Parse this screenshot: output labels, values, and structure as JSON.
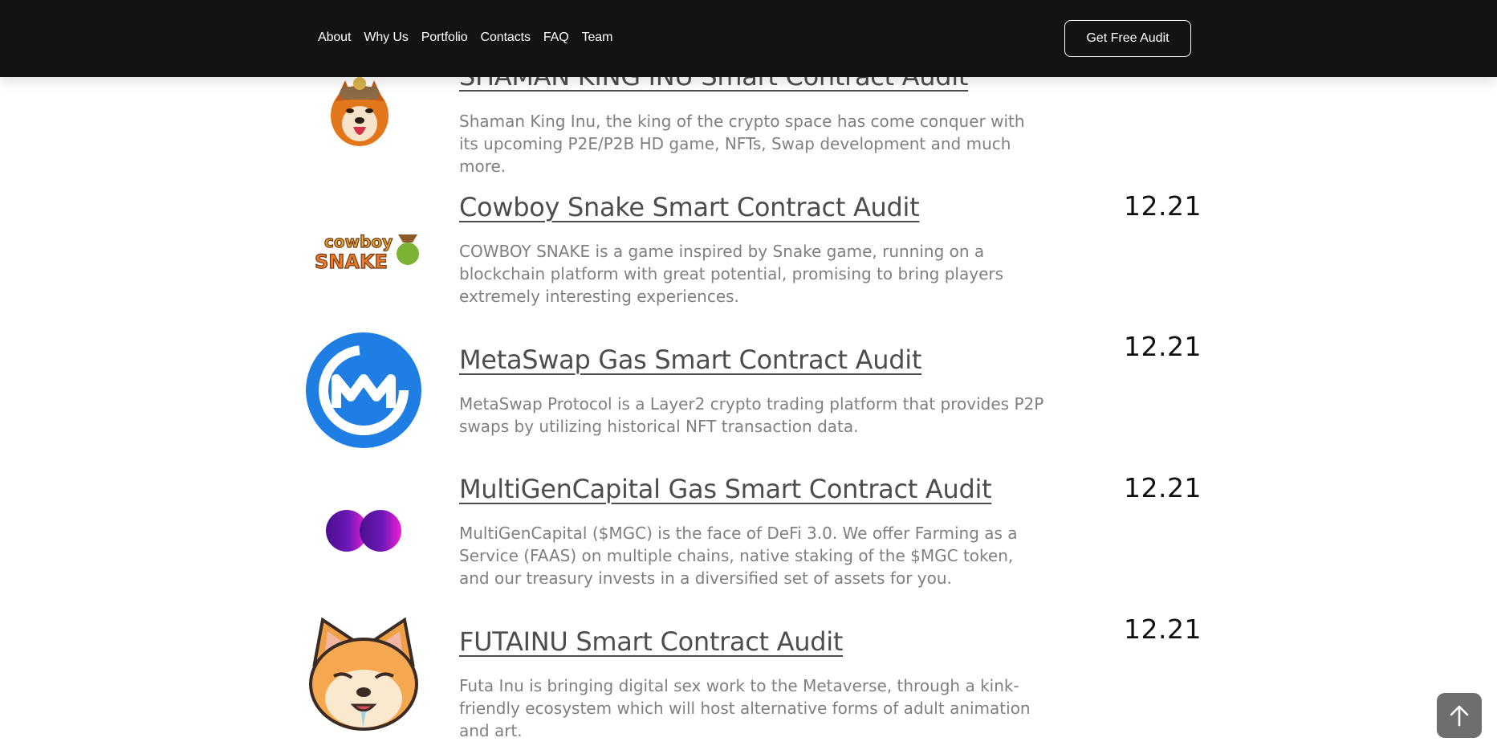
{
  "header": {
    "nav": [
      "About",
      "Why Us",
      "Portfolio",
      "Contacts",
      "FAQ",
      "Team"
    ],
    "cta_label": "Get Free Audit"
  },
  "audits": [
    {
      "title": "SHAMAN KING INU Smart Contract Audit",
      "description": "Shaman King Inu, the king of the crypto space has come conquer with its upcoming P2E/P2B HD game, NFTs, Swap development and much more.",
      "date": "",
      "logo_icon": "shiba-warrior-icon"
    },
    {
      "title": "Cowboy Snake Smart Contract Audit",
      "description": "COWBOY SNAKE is a game inspired by Snake game,  running on a blockchain platform with great potential, promising to bring players extremely interesting experiences.",
      "date": "12.21",
      "logo_icon": "cowboy-snake-logo-icon",
      "logo_text_top": "cowboy",
      "logo_text_bottom": "SNAKE"
    },
    {
      "title": "MetaSwap Gas Smart Contract Audit",
      "description": "MetaSwap Protocol is a Layer2 crypto trading platform that provides P2P swaps by utilizing historical NFT transaction data.",
      "date": "12.21",
      "logo_icon": "metaswap-logo-icon"
    },
    {
      "title": "MultiGenCapital Gas Smart Contract Audit",
      "description": "MultiGenCapital ($MGC) is the face of DeFi 3.0. We offer Farming as a Service (FAAS) on multiple chains, native staking of the $MGC token, and our treasury invests in a diversified set of assets for you.",
      "date": "12.21",
      "logo_icon": "infinity-logo-icon"
    },
    {
      "title": "FUTAINU Smart Contract Audit",
      "description": "Futa Inu is bringing digital sex work to the Metaverse, through a kink-friendly ecosystem which will host alternative forms of adult animation and art.",
      "date": "12.21",
      "logo_icon": "shiba-face-icon"
    }
  ],
  "colors": {
    "header_bg": "#131313",
    "metaswap_blue": "#1e7ee4",
    "infinity_purple": "#5a139b",
    "infinity_magenta": "#f01dd8"
  },
  "back_to_top_icon": "arrow-up-icon"
}
